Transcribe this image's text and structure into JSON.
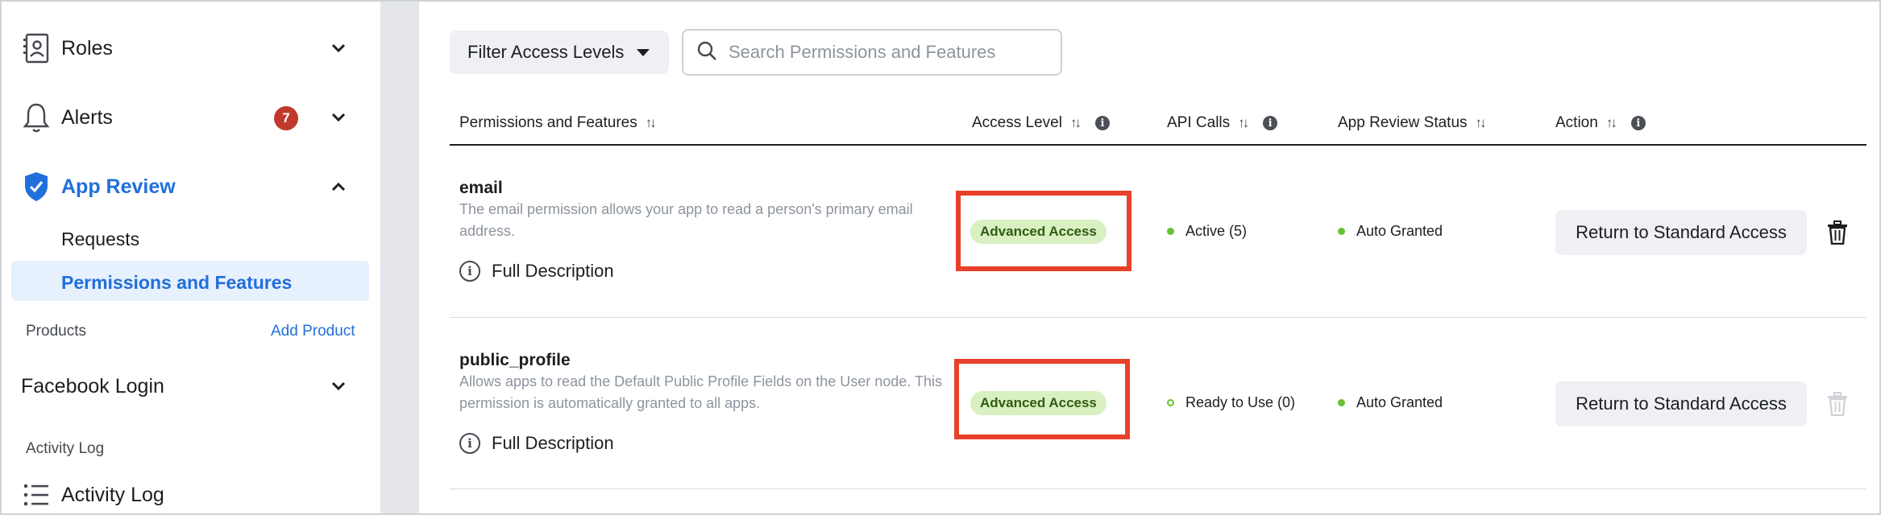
{
  "sidebar": {
    "roles_label": "Roles",
    "alerts_label": "Alerts",
    "alerts_count": "7",
    "app_review_label": "App Review",
    "requests_label": "Requests",
    "permissions_label": "Permissions and Features",
    "products_label": "Products",
    "add_product_label": "Add Product",
    "facebook_login_label": "Facebook Login",
    "activity_log_section": "Activity Log",
    "activity_log_label": "Activity Log"
  },
  "toolbar": {
    "filter_label": "Filter Access Levels",
    "search_placeholder": "Search Permissions and Features"
  },
  "table": {
    "columns": {
      "permissions": "Permissions and Features",
      "access_level": "Access Level",
      "api_calls": "API Calls",
      "review_status": "App Review Status",
      "action": "Action"
    },
    "rows": [
      {
        "name": "email",
        "description": "The email permission allows your app to read a person's primary email address.",
        "full_description": "Full Description",
        "access_level": "Advanced Access",
        "api_calls": "Active (5)",
        "review_status": "Auto Granted",
        "action": "Return to Standard Access"
      },
      {
        "name": "public_profile",
        "description": "Allows apps to read the Default Public Profile Fields on the User node. This permission is automatically granted to all apps.",
        "full_description": "Full Description",
        "access_level": "Advanced Access",
        "api_calls": "Ready to Use (0)",
        "review_status": "Auto Granted",
        "action": "Return to Standard Access"
      }
    ]
  },
  "colors": {
    "accent": "#216fdb",
    "badge": "#c0392b",
    "highlight": "#e8402a",
    "pill_bg": "#d9f0c2",
    "status_green": "#6abf35"
  }
}
